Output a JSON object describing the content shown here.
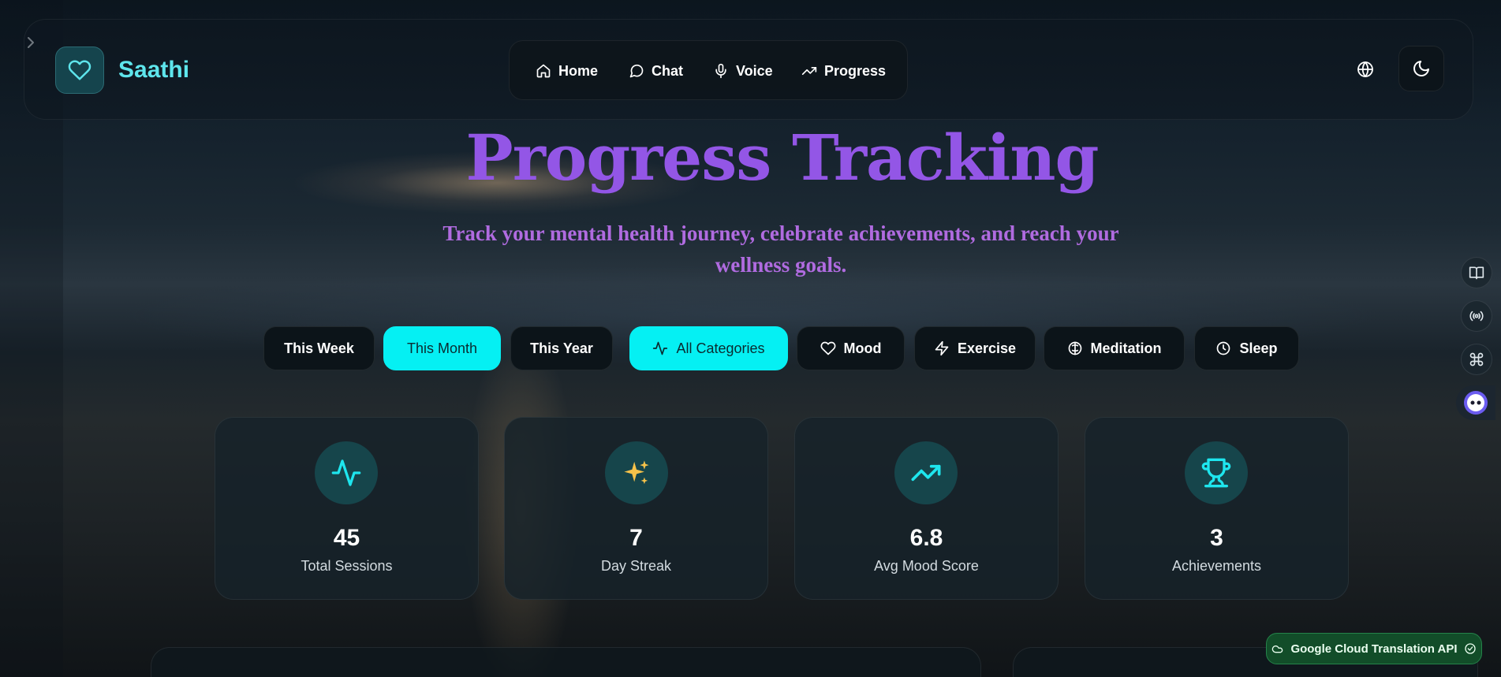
{
  "app": {
    "brand": "Saathi"
  },
  "nav": {
    "items": [
      {
        "label": "Home",
        "icon": "home-icon"
      },
      {
        "label": "Chat",
        "icon": "chat-icon"
      },
      {
        "label": "Voice",
        "icon": "mic-icon"
      },
      {
        "label": "Progress",
        "icon": "trending-up-icon"
      }
    ]
  },
  "hero": {
    "title": "Progress Tracking",
    "subtitle_line1": "Track your mental health journey, celebrate achievements, and reach your",
    "subtitle_line2": "wellness goals."
  },
  "filters": {
    "time_ranges": [
      {
        "label": "This Week",
        "active": false
      },
      {
        "label": "This Month",
        "active": true
      },
      {
        "label": "This Year",
        "active": false
      }
    ],
    "categories": [
      {
        "label": "All Categories",
        "icon": "activity-icon",
        "active": true
      },
      {
        "label": "Mood",
        "icon": "heart-icon",
        "active": false
      },
      {
        "label": "Exercise",
        "icon": "lightning-icon",
        "active": false
      },
      {
        "label": "Meditation",
        "icon": "brain-icon",
        "active": false
      },
      {
        "label": "Sleep",
        "icon": "clock-icon",
        "active": false
      }
    ]
  },
  "stats": [
    {
      "value": "45",
      "label": "Total Sessions",
      "icon": "activity-icon"
    },
    {
      "value": "7",
      "label": "Day Streak",
      "icon": "sparkles-icon"
    },
    {
      "value": "6.8",
      "label": "Avg Mood Score",
      "icon": "trending-up-icon"
    },
    {
      "value": "3",
      "label": "Achievements",
      "icon": "trophy-icon"
    }
  ],
  "badge": {
    "label": "Google Cloud Translation API"
  },
  "colors": {
    "accent": "#05f0f3",
    "title": "#9356e6",
    "subtitle": "#b06be0",
    "brand": "#5ee5ec"
  }
}
